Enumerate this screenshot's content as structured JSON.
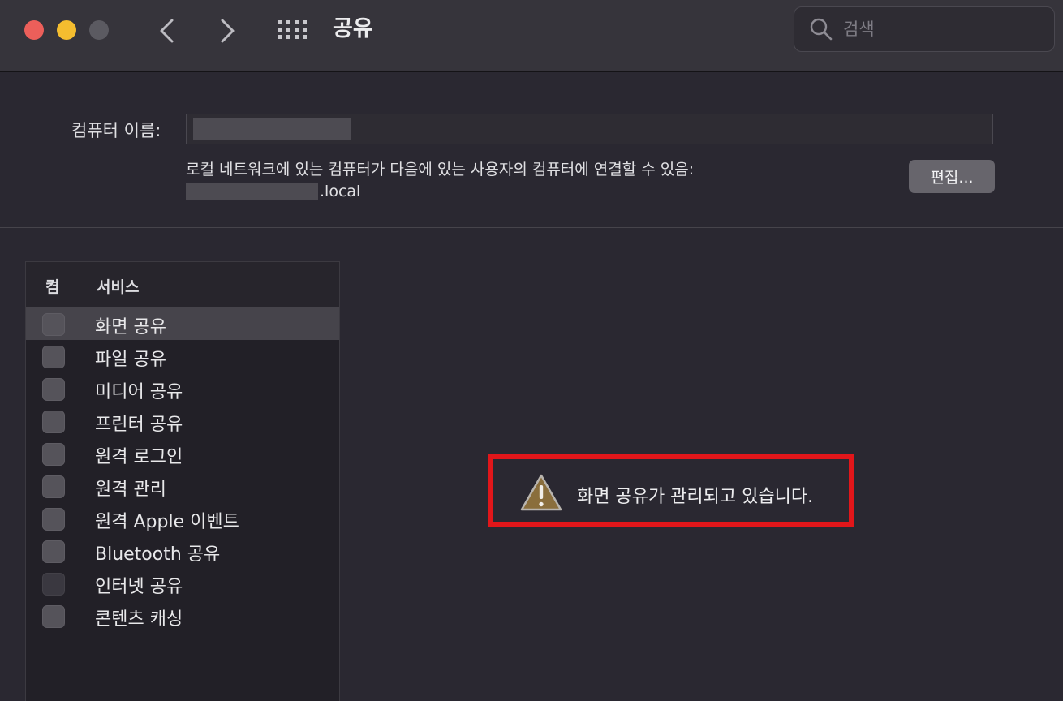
{
  "window": {
    "title": "공유",
    "search_placeholder": "검색"
  },
  "computer_name": {
    "label": "컴퓨터 이름:",
    "value": ""
  },
  "local_network": {
    "description": "로컬 네트워크에 있는 컴퓨터가 다음에 있는 사용자의 컴퓨터에 연결할 수 있음:",
    "address_suffix": ".local",
    "edit_button": "편집..."
  },
  "services": {
    "header_on": "켬",
    "header_service": "서비스",
    "items": [
      {
        "label": "화면 공유",
        "checked": false,
        "selected": true,
        "enabled": true
      },
      {
        "label": "파일 공유",
        "checked": false,
        "selected": false,
        "enabled": true
      },
      {
        "label": "미디어 공유",
        "checked": false,
        "selected": false,
        "enabled": true
      },
      {
        "label": "프린터 공유",
        "checked": false,
        "selected": false,
        "enabled": true
      },
      {
        "label": "원격 로그인",
        "checked": false,
        "selected": false,
        "enabled": true
      },
      {
        "label": "원격 관리",
        "checked": false,
        "selected": false,
        "enabled": true
      },
      {
        "label": "원격 Apple 이벤트",
        "checked": false,
        "selected": false,
        "enabled": true
      },
      {
        "label": "Bluetooth 공유",
        "checked": false,
        "selected": false,
        "enabled": true
      },
      {
        "label": "인터넷 공유",
        "checked": false,
        "selected": false,
        "enabled": false
      },
      {
        "label": "콘텐츠 캐싱",
        "checked": false,
        "selected": false,
        "enabled": true
      }
    ]
  },
  "notice": {
    "message": "화면 공유가 관리되고 있습니다.",
    "icon": "warning-icon",
    "highlight_color": "#e1161a"
  },
  "colors": {
    "close": "#ec5f5a",
    "minimize": "#f4bd2f",
    "zoom": "#5b5a61"
  }
}
